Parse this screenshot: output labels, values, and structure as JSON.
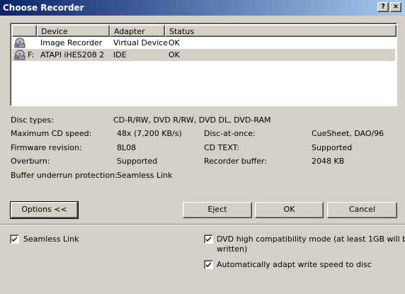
{
  "window": {
    "title": "Choose Recorder",
    "help_btn": "?",
    "close_btn": "×"
  },
  "devices": {
    "columns": [
      "Device",
      "Adapter",
      "Status"
    ],
    "rows": [
      {
        "prefix": "",
        "device": "Image Recorder",
        "adapter": "Virtual Device",
        "status": "OK",
        "icon": "disc-drive-icon"
      },
      {
        "prefix": "F:",
        "device": "ATAPI iHES208   2",
        "adapter": "IDE",
        "status": "OK",
        "icon": "disc-drive-icon"
      }
    ]
  },
  "info": {
    "disc_types_label": "Disc types:",
    "disc_types_value": "CD-R/RW, DVD R/RW, DVD DL, DVD-RAM",
    "max_speed_label": "Maximum CD speed:",
    "max_speed_value": "48x (7,200 KB/s)",
    "dao_label": "Disc-at-once:",
    "dao_value": "CueSheet, DAO/96",
    "firmware_label": "Firmware revision:",
    "firmware_value": "8L08",
    "cdtext_label": "CD TEXT:",
    "cdtext_value": "Supported",
    "overburn_label": "Overburn:",
    "overburn_value": "Supported",
    "buffer_label": "Recorder buffer:",
    "buffer_value": "2048 KB",
    "underrun_label": "Buffer underrun protection:",
    "underrun_value": "Seamless Link"
  },
  "buttons": {
    "options": "Options <<",
    "eject": "Eject",
    "ok": "OK",
    "cancel": "Cancel"
  },
  "options": {
    "seamless": "Seamless Link",
    "dvd_compat_line1": "DVD high compatibility mode (at least 1GB will be",
    "dvd_compat_line2": "written)",
    "auto_speed": "Automatically adapt write speed to disc"
  }
}
